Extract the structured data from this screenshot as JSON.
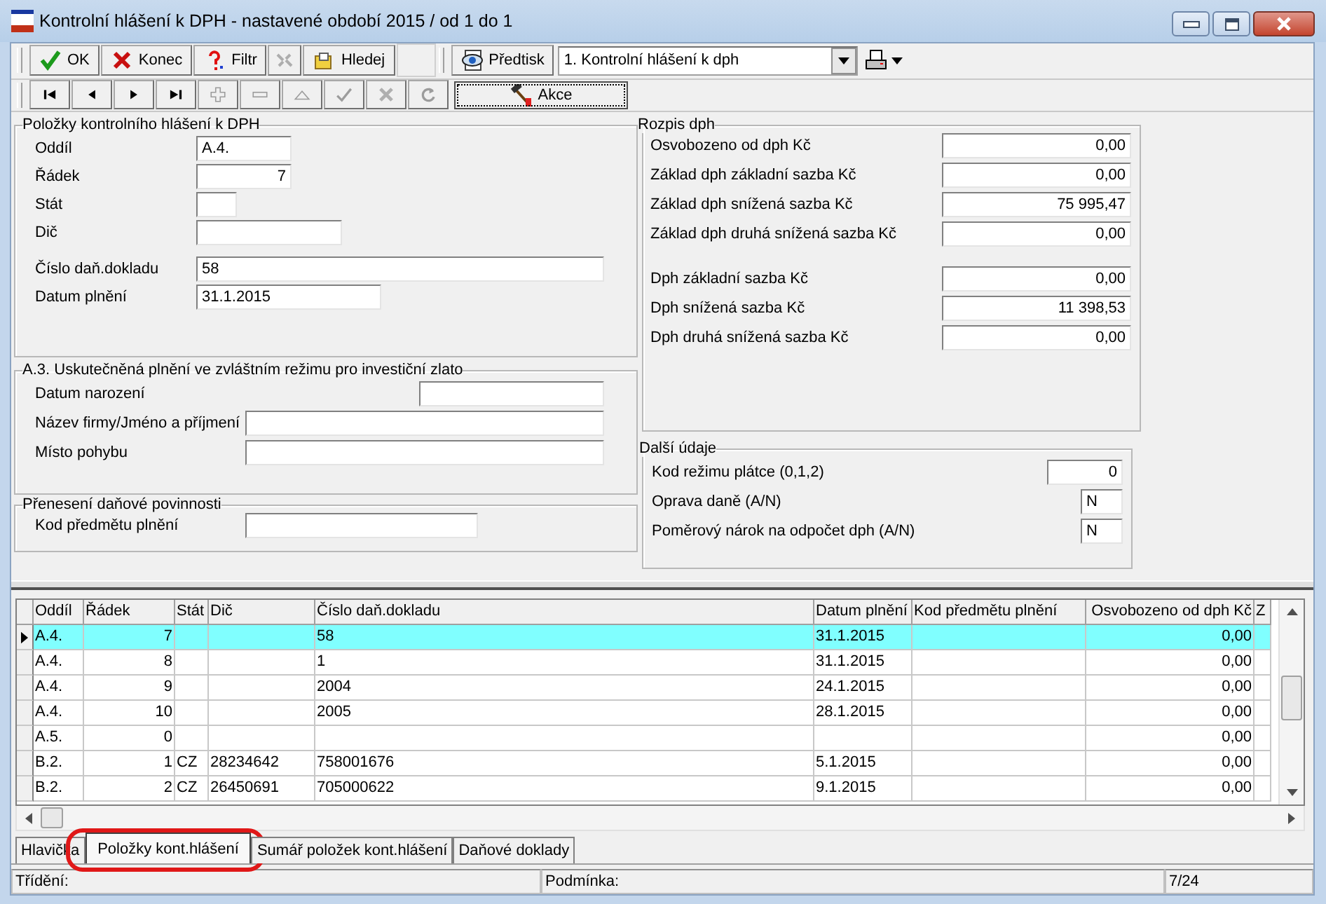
{
  "window": {
    "title": "Kontrolní hlášení k DPH - nastavené období 2015 / od 1 do 1"
  },
  "toolbar": {
    "items": [
      {
        "kind": "ok",
        "label": "OK",
        "disabled": false
      },
      {
        "kind": "cancel",
        "label": "Konec",
        "disabled": false
      },
      {
        "kind": "filter",
        "label": "Filtr",
        "disabled": false
      },
      {
        "kind": "link",
        "disabled": true
      },
      {
        "kind": "search",
        "label": "Hledej",
        "disabled": false
      }
    ],
    "preview": {
      "label": "Předtisk"
    },
    "report_select": {
      "value": "1. Kontrolní hlášení k dph"
    }
  },
  "nav_toolbar": {
    "buttons": [
      {
        "kind": "first",
        "disabled": false
      },
      {
        "kind": "prev",
        "disabled": false
      },
      {
        "kind": "next",
        "disabled": false
      },
      {
        "kind": "last",
        "disabled": false
      },
      {
        "kind": "add",
        "disabled": true
      },
      {
        "kind": "remove",
        "disabled": true
      },
      {
        "kind": "edit",
        "disabled": true
      },
      {
        "kind": "confirm",
        "disabled": true
      },
      {
        "kind": "cancel",
        "disabled": true
      },
      {
        "kind": "refresh",
        "disabled": true
      }
    ],
    "action": {
      "label": "Akce"
    }
  },
  "items_group": {
    "title": "Položky kontrolního hlášení k DPH",
    "fields": [
      {
        "label": "Oddíl",
        "value": "A.4.",
        "kind": "code"
      },
      {
        "label": "Řádek",
        "value": "7",
        "kind": "number"
      },
      {
        "label": "Stát",
        "kind": "tiny"
      },
      {
        "label": "Dič",
        "kind": "medium"
      },
      {
        "label": "Číslo daň.dokladu",
        "value": "58",
        "kind": "long"
      },
      {
        "label": "Datum plnění",
        "value": "31.1.2015",
        "kind": "date"
      }
    ]
  },
  "gold_group": {
    "title": "A.3. Uskutečněná plnění ve zvláštním režimu pro investiční zlato",
    "fields": [
      {
        "label": "Datum narození",
        "kind": "date"
      },
      {
        "label": "Název firmy/Jméno a příjmení",
        "kind": "long"
      },
      {
        "label": "Místo pohybu",
        "kind": "long"
      }
    ]
  },
  "transfer_group": {
    "title": "Přenesení daňové povinnosti",
    "fields": [
      {
        "label": "Kod předmětu plnění",
        "kind": "medium"
      }
    ]
  },
  "vat_group": {
    "title": "Rozpis dph",
    "base_fields": [
      {
        "label": "Osvobozeno od dph Kč",
        "value": "0,00"
      },
      {
        "label": "Základ dph základní sazba Kč",
        "value": "0,00"
      },
      {
        "label": "Základ dph snížená sazba Kč",
        "value": "75 995,47"
      },
      {
        "label": "Základ dph druhá snížená sazba Kč",
        "value": "0,00"
      }
    ],
    "tax_fields": [
      {
        "label": "Dph základní sazba Kč",
        "value": "0,00"
      },
      {
        "label": "Dph snížená sazba Kč",
        "value": "11 398,53"
      },
      {
        "label": "Dph druhá snížená sazba Kč",
        "value": "0,00"
      }
    ]
  },
  "other_group": {
    "title": "Další údaje",
    "fields": [
      {
        "label": "Kod režimu plátce (0,1,2)",
        "value": "0",
        "kind": "number"
      },
      {
        "label": "Oprava daně (A/N)",
        "value": "N",
        "kind": "flag"
      },
      {
        "label": "Poměrový nárok na odpočet dph (A/N)",
        "value": "N",
        "kind": "flag"
      }
    ]
  },
  "table": {
    "columns": [
      "Oddíl",
      "Řádek",
      "Stát",
      "Dič",
      "Číslo daň.dokladu",
      "Datum plnění",
      "Kod předmětu plnění",
      "Osvobozeno od dph Kč",
      "Z"
    ],
    "rows": [
      {
        "selected": true,
        "cells": [
          "A.4.",
          "7",
          null,
          null,
          "58",
          "31.1.2015",
          null,
          "0,00"
        ]
      },
      {
        "selected": false,
        "cells": [
          "A.4.",
          "8",
          null,
          null,
          "1",
          "31.1.2015",
          null,
          "0,00"
        ]
      },
      {
        "selected": false,
        "cells": [
          "A.4.",
          "9",
          null,
          null,
          "2004",
          "24.1.2015",
          null,
          "0,00"
        ]
      },
      {
        "selected": false,
        "cells": [
          "A.4.",
          "10",
          null,
          null,
          "2005",
          "28.1.2015",
          null,
          "0,00"
        ]
      },
      {
        "selected": false,
        "cells": [
          "A.5.",
          "0",
          null,
          null,
          null,
          null,
          null,
          "0,00"
        ]
      },
      {
        "selected": false,
        "cells": [
          "B.2.",
          "1",
          "CZ",
          "28234642",
          "758001676",
          "5.1.2015",
          null,
          "0,00"
        ]
      },
      {
        "selected": false,
        "cells": [
          "B.2.",
          "2",
          "CZ",
          "26450691",
          "705000622",
          "9.1.2015",
          null,
          "0,00"
        ]
      }
    ]
  },
  "tabs": [
    {
      "label": "Hlavička",
      "selected": false,
      "highlighted": false
    },
    {
      "label": "Položky kont.hlášení",
      "selected": true,
      "highlighted": true
    },
    {
      "label": "Sumář položek kont.hlášení",
      "selected": false,
      "highlighted": false
    },
    {
      "label": "Daňové doklady",
      "selected": false,
      "highlighted": false
    }
  ],
  "status_bar": [
    "Třídění:",
    "Podmínka:",
    "7/24"
  ]
}
